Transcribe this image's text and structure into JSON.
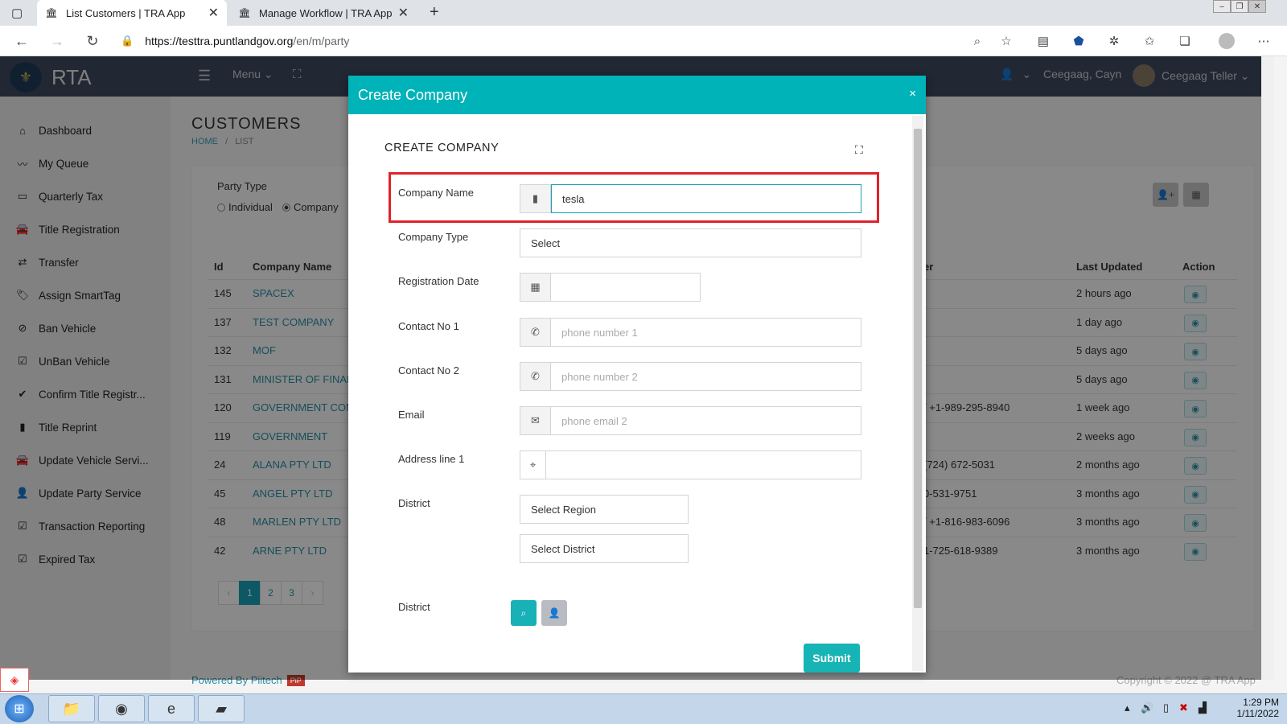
{
  "browser": {
    "tabs": [
      {
        "title": "List Customers | TRA App",
        "active": true
      },
      {
        "title": "Manage Workflow | TRA App",
        "active": false
      }
    ],
    "url_host": "https://testtra.puntlandgov.org",
    "url_path": "/en/m/party",
    "new_tab": "+",
    "close_glyph": "✕"
  },
  "header": {
    "brand": "RTA",
    "menu_label": "Menu ⌄",
    "user_short": "Ceegaag, Cayn",
    "user_name": "Ceegaag Teller ⌄",
    "user_caret": "⌄"
  },
  "sidebar": {
    "items": [
      {
        "label": "Dashboard",
        "icon": "home-icon"
      },
      {
        "label": "My Queue",
        "icon": "trend-icon"
      },
      {
        "label": "Quarterly Tax",
        "icon": "card-icon"
      },
      {
        "label": "Title Registration",
        "icon": "car-icon"
      },
      {
        "label": "Transfer",
        "icon": "exchange-icon"
      },
      {
        "label": "Assign SmartTag",
        "icon": "tag-icon"
      },
      {
        "label": "Ban Vehicle",
        "icon": "ban-icon"
      },
      {
        "label": "UnBan Vehicle",
        "icon": "check-square-icon"
      },
      {
        "label": "Confirm Title Registr...",
        "icon": "check-icon"
      },
      {
        "label": "Title Reprint",
        "icon": "file-icon"
      },
      {
        "label": "Update Vehicle Servi...",
        "icon": "car-icon"
      },
      {
        "label": "Update Party Service",
        "icon": "user-icon"
      },
      {
        "label": "Transaction Reporting",
        "icon": "check-square-icon"
      },
      {
        "label": "Expired Tax",
        "icon": "check-square-icon"
      }
    ]
  },
  "page": {
    "title": "CUSTOMERS",
    "breadcrumb_home": "HOME",
    "breadcrumb_sep": "/",
    "breadcrumb_current": "LIST",
    "party_type_label": "Party Type",
    "radio_individual": "Individual",
    "radio_company": "Company"
  },
  "table": {
    "headers": {
      "id": "Id",
      "name": "Company Name",
      "phone": "er",
      "updated": "Last Updated",
      "action": "Action"
    },
    "rows": [
      {
        "id": "145",
        "name": "SPACEX",
        "phone": "",
        "updated": "2 hours ago"
      },
      {
        "id": "137",
        "name": "TEST COMPANY",
        "phone": "",
        "updated": "1 day ago"
      },
      {
        "id": "132",
        "name": "MOF",
        "phone": "",
        "updated": "5 days ago"
      },
      {
        "id": "131",
        "name": "MINISTER OF FINAN",
        "phone": "",
        "updated": "5 days ago"
      },
      {
        "id": "120",
        "name": "GOVERNMENT COM",
        "phone": "/ +1-989-295-8940",
        "updated": "1 week ago"
      },
      {
        "id": "119",
        "name": "GOVERNMENT",
        "phone": "",
        "updated": "2 weeks ago"
      },
      {
        "id": "24",
        "name": "ALANA PTY LTD",
        "phone": "(724) 672-5031",
        "updated": "2 months ago"
      },
      {
        "id": "45",
        "name": "ANGEL PTY LTD",
        "phone": "0-531-9751",
        "updated": "3 months ago"
      },
      {
        "id": "48",
        "name": "MARLEN PTY LTD",
        "phone": "/ +1-816-983-6096",
        "updated": "3 months ago"
      },
      {
        "id": "42",
        "name": "ARNE PTY LTD",
        "phone": "1-725-618-9389",
        "updated": "3 months ago"
      }
    ]
  },
  "pager": {
    "prev": "‹",
    "pages": [
      "1",
      "2",
      "3"
    ],
    "next": "›"
  },
  "footer": {
    "powered": "Powered By Piitech",
    "badge": "PiP",
    "copyright": "Copyright © 2022 @ TRA App"
  },
  "modal": {
    "header_title": "Create Company",
    "close": "×",
    "title": "CREATE COMPANY",
    "company_name_label": "Company Name",
    "company_name_value": "tesla",
    "company_type_label": "Company Type",
    "company_type_value": "Select",
    "registration_date_label": "Registration Date",
    "contact1_label": "Contact No 1",
    "contact1_placeholder": "phone number 1",
    "contact2_label": "Contact No 2",
    "contact2_placeholder": "phone number 2",
    "email_label": "Email",
    "email_placeholder": "phone email 2",
    "address_label": "Address line 1",
    "district_label": "District",
    "region_select": "Select Region",
    "district_select": "Select District",
    "district2_label": "District",
    "submit": "Submit"
  },
  "taskbar": {
    "time": "1:29 PM",
    "date": "1/11/2022"
  },
  "colors": {
    "accent": "#00b3b8",
    "header": "#3c4a5e",
    "highlight": "#e0222a"
  }
}
